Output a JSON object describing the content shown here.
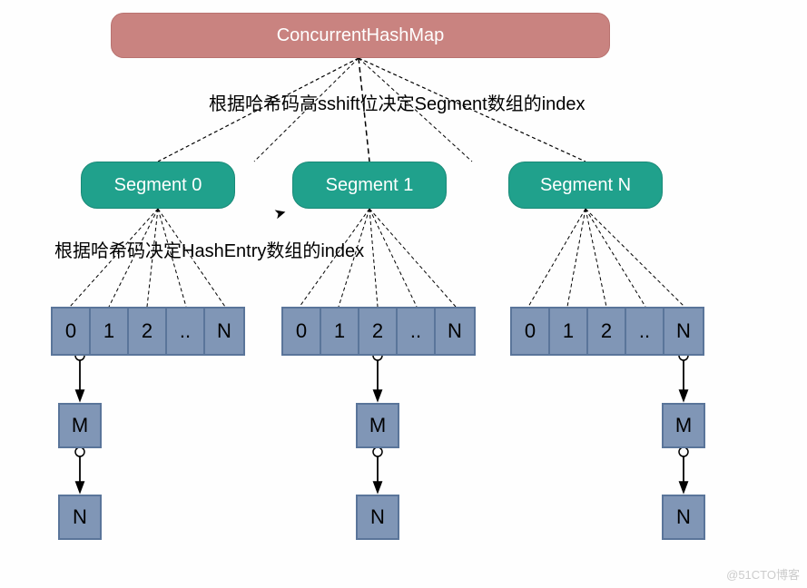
{
  "title": "ConcurrentHashMap",
  "captions": {
    "segment_index": "根据哈希码高sshift位决定Segment数组的index",
    "entry_index": "根据哈希码决定HashEntry数组的index"
  },
  "segments": [
    {
      "label": "Segment 0"
    },
    {
      "label": "Segment 1"
    },
    {
      "label": "Segment N"
    }
  ],
  "entry_cells": [
    "0",
    "1",
    "2",
    "..",
    "N"
  ],
  "chain_nodes": {
    "first": "M",
    "second": "N"
  },
  "watermark": "@51CTO博客"
}
